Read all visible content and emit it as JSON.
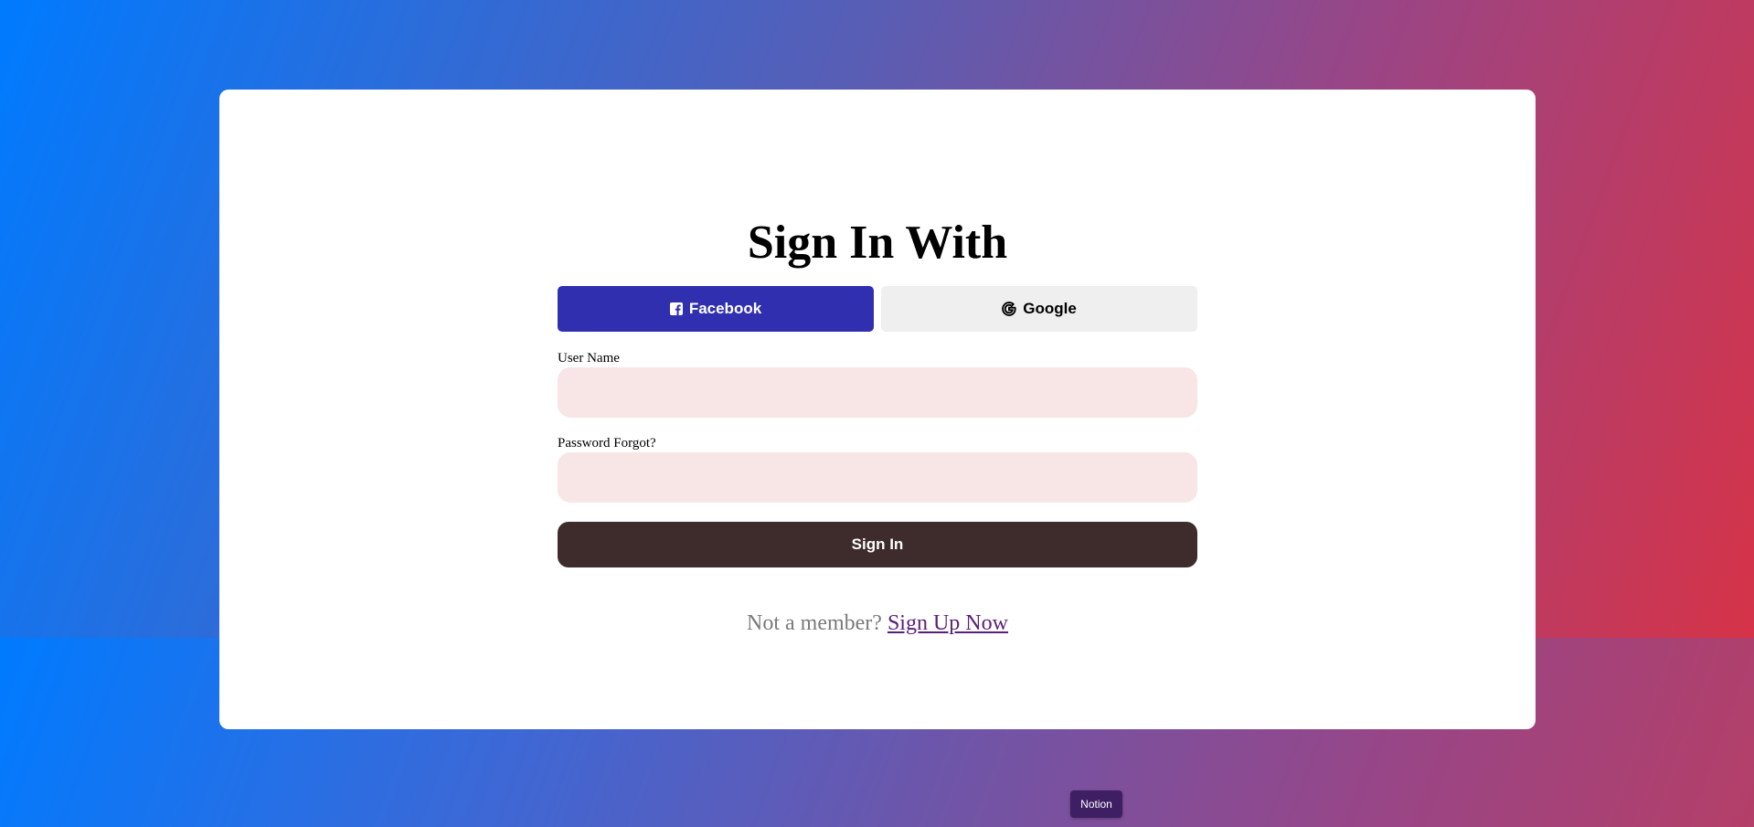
{
  "colors": {
    "facebook": "#2f2fb0",
    "google_bg": "#efefef",
    "input_bg": "#f8e5e5",
    "signin_bg": "#3e2c2c",
    "link": "#5a1f7a",
    "gradient_start": "#007bff",
    "gradient_end": "#d63348"
  },
  "form": {
    "title": "Sign In With",
    "facebook_label": "Facebook",
    "facebook_icon": "facebook-square-icon",
    "google_label": "Google",
    "google_icon": "google-g-icon",
    "username_label": "User Name",
    "username_value": "",
    "password_label": "Password Forgot?",
    "password_value": "",
    "signin_label": "Sign In",
    "not_member_text": "Not a member?",
    "signup_link": "Sign Up Now"
  },
  "badge": {
    "label": "Notion"
  }
}
